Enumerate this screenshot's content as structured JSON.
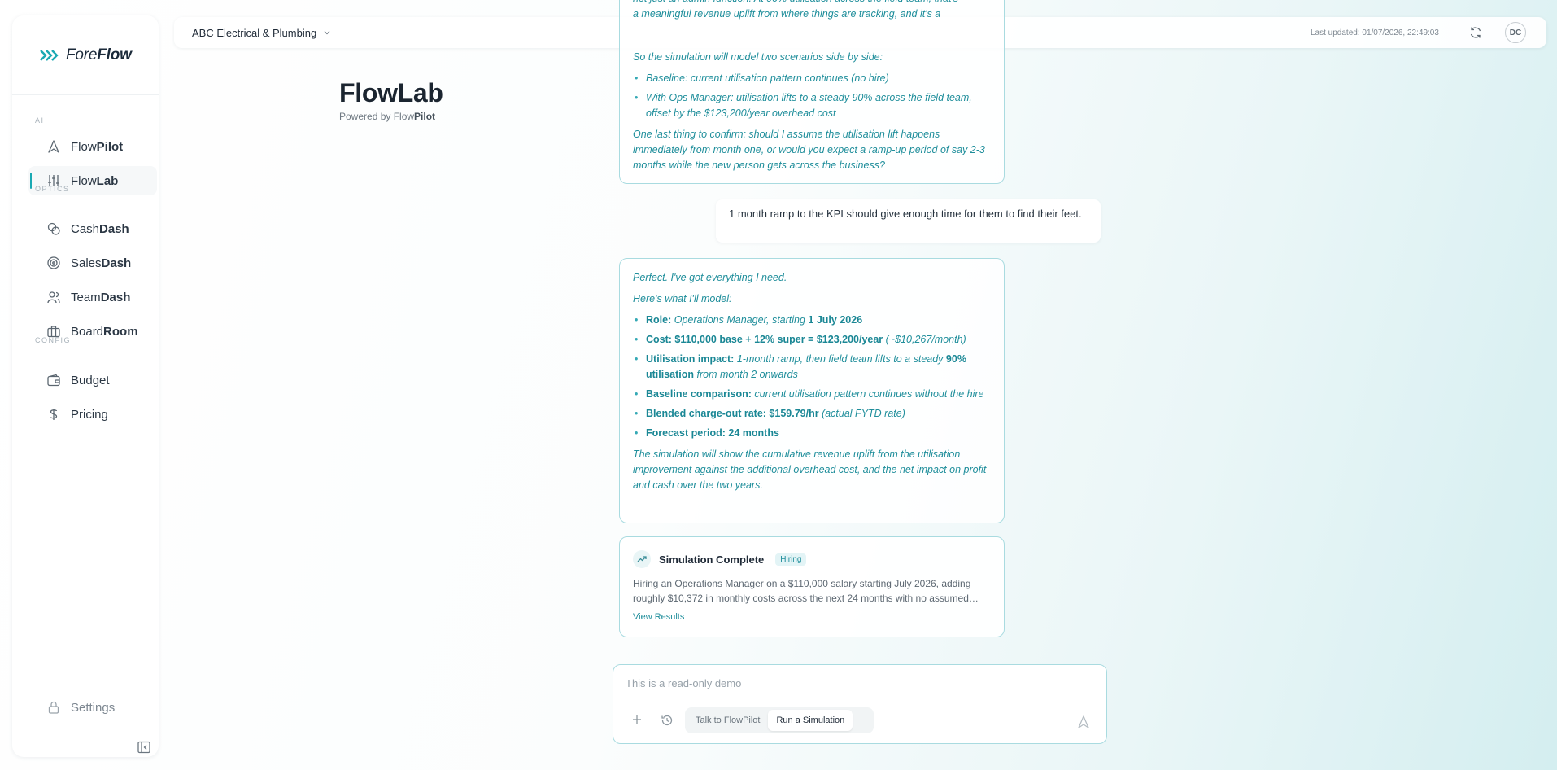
{
  "brand": {
    "logo_light": "Fore",
    "logo_bold": "Flow"
  },
  "sidebar": {
    "sections": {
      "ai": "AI",
      "optics": "OPTICS",
      "config": "CONFIG"
    },
    "items": [
      {
        "light": "Flow",
        "bold": "Pilot",
        "icon": "pilot-icon"
      },
      {
        "light": "Flow",
        "bold": "Lab",
        "icon": "sliders-icon",
        "active": true
      },
      {
        "light": "Cash",
        "bold": "Dash",
        "icon": "coins-icon"
      },
      {
        "light": "Sales",
        "bold": "Dash",
        "icon": "target-icon"
      },
      {
        "light": "Team",
        "bold": "Dash",
        "icon": "users-icon"
      },
      {
        "light": "Board",
        "bold": "Room",
        "icon": "briefcase-icon"
      },
      {
        "light": "Budget",
        "bold": "",
        "icon": "wallet-icon"
      },
      {
        "light": "Pricing",
        "bold": "",
        "icon": "dollar-icon"
      }
    ],
    "settings": "Settings"
  },
  "header": {
    "company": "ABC Electrical & Plumbing",
    "last_updated": "Last updated: 01/07/2026, 22:49:03",
    "avatar": "DC"
  },
  "page": {
    "title_light": "Flow",
    "title_bold": "Lab",
    "subtitle_prefix": "Powered by Flow",
    "subtitle_bold": "Pilot"
  },
  "chat": {
    "card1": {
      "cut_line_1": "not just an admin function. At 90% utilisation across the field team, that's",
      "cut_line_2": "a meaningful revenue uplift from where things are tracking, and it's a",
      "intro": "So the simulation will model two scenarios side by side:",
      "bullets": [
        "Baseline: current utilisation pattern continues (no hire)",
        "With Ops Manager: utilisation lifts to a steady 90% across the field team, offset by the $123,200/year overhead cost"
      ],
      "question": "One last thing to confirm: should I assume the utilisation lift happens immediately from month one, or would you expect a ramp-up period of say 2-3 months while the new person gets across the business?"
    },
    "user_message": "1 month ramp to the KPI should give enough time for them to find their feet.",
    "card2": {
      "line1": "Perfect. I've got everything I need.",
      "line2": "Here's what I'll model:",
      "role_label": "Role:",
      "role_text": "Operations Manager, starting",
      "role_date": "1 July 2026",
      "cost_label": "Cost: $110,000 base + 12% super = $123,200/year",
      "cost_note": "(~$10,267/month)",
      "util_label": "Utilisation impact:",
      "util_text": "1-month ramp, then field team lifts to a steady",
      "util_bold": "90% utilisation",
      "util_tail": "from month 2 onwards",
      "base_label": "Baseline comparison:",
      "base_text": "current utilisation pattern continues without the hire",
      "rate_label": "Blended charge-out rate: $159.79/hr",
      "rate_note": "(actual FYTD rate)",
      "period_label": "Forecast period: 24 months",
      "closing": "The simulation will show the cumulative revenue uplift from the utilisation improvement against the additional overhead cost, and the net impact on profit and cash over the two years."
    },
    "simulation": {
      "title": "Simulation Complete",
      "badge": "Hiring",
      "description": "Hiring an Operations Manager on a $110,000 salary starting July 2026, adding roughly $10,372 in monthly costs across the next 24 months with no assumed…",
      "link": "View Results"
    }
  },
  "composer": {
    "placeholder": "This is a read-only demo",
    "modes": [
      "Talk to FlowPilot",
      "Run a Simulation"
    ],
    "active_mode": "Run a Simulation"
  },
  "colors": {
    "accent": "#1aa9b3",
    "ai_text": "#1f8e9b",
    "border": "#a9dbe0"
  }
}
